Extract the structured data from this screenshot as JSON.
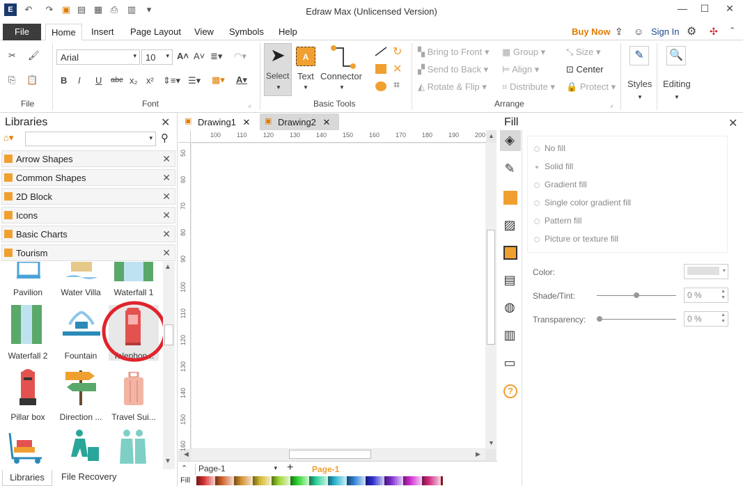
{
  "window": {
    "title": "Edraw Max (Unlicensed Version)"
  },
  "menu": {
    "file": "File",
    "tabs": [
      "Home",
      "Insert",
      "Page Layout",
      "View",
      "Symbols",
      "Help"
    ],
    "buy_now": "Buy Now",
    "sign_in": "Sign In"
  },
  "ribbon": {
    "file_group": "File",
    "font_group": "Font",
    "font_name": "Arial",
    "font_size": "10",
    "basic_tools_group": "Basic Tools",
    "select": "Select",
    "text": "Text",
    "connector": "Connector",
    "arrange_group": "Arrange",
    "bring_to_front": "Bring to Front",
    "send_to_back": "Send to Back",
    "rotate_flip": "Rotate & Flip",
    "group": "Group",
    "align": "Align",
    "distribute": "Distribute",
    "size": "Size",
    "center": "Center",
    "protect": "Protect",
    "styles": "Styles",
    "editing": "Editing"
  },
  "libraries": {
    "title": "Libraries",
    "items": [
      "Arrow Shapes",
      "Common Shapes",
      "2D Block",
      "Icons",
      "Basic Charts",
      "Tourism"
    ],
    "shapes": [
      "Pavilion",
      "Water Villa",
      "Waterfall 1",
      "Waterfall 2",
      "Fountain",
      "Telephon...",
      "Pillar box",
      "Direction ...",
      "Travel Sui..."
    ],
    "bottom_tabs": [
      "Libraries",
      "File Recovery"
    ]
  },
  "documents": {
    "tabs": [
      "Drawing1",
      "Drawing2"
    ]
  },
  "ruler": {
    "h": [
      "100",
      "110",
      "120",
      "130",
      "140",
      "150",
      "160",
      "170",
      "180",
      "190",
      "200"
    ],
    "v": [
      "50",
      "60",
      "70",
      "80",
      "90",
      "100",
      "110",
      "120",
      "130",
      "140",
      "150",
      "160"
    ]
  },
  "pages": {
    "current": "Page-1",
    "active_tab": "Page-1",
    "fill_label": "Fill"
  },
  "fill_panel": {
    "title": "Fill",
    "options": [
      "No fill",
      "Solid fill",
      "Gradient fill",
      "Single color gradient fill",
      "Pattern fill",
      "Picture or texture fill"
    ],
    "selected": "Solid fill",
    "color_label": "Color:",
    "shade_label": "Shade/Tint:",
    "shade_value": "0 %",
    "transparency_label": "Transparency:",
    "transparency_value": "0 %"
  },
  "colors": {
    "accent": "#f0a030",
    "buy_now": "#e07b00",
    "highlight": "#e0242c"
  }
}
